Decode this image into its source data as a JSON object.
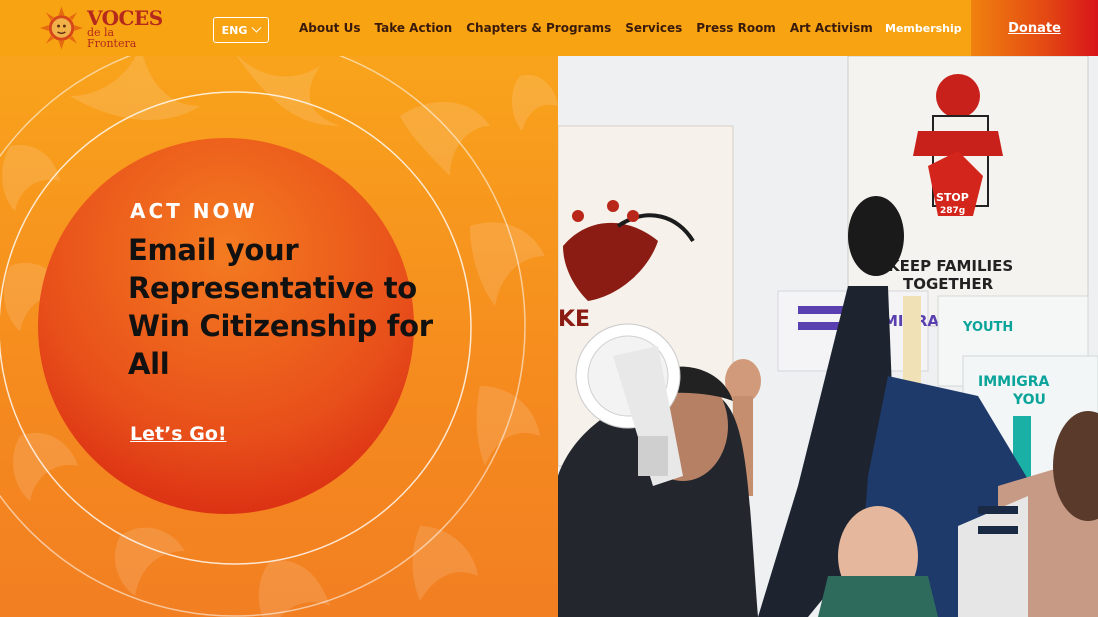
{
  "brand": {
    "name_line1": "VOCES",
    "name_line2": "de la Frontera"
  },
  "header": {
    "language": "ENG",
    "nav": [
      "About Us",
      "Take Action",
      "Chapters & Programs",
      "Services",
      "Press Room",
      "Art Activism"
    ],
    "membership": "Membership",
    "donate": "Donate"
  },
  "hero": {
    "eyebrow": "ACT NOW",
    "headline": "Email your Representative to Win Citizenship for All",
    "cta": "Let’s Go!"
  },
  "photo": {
    "signs": {
      "stop": "STOP",
      "stop_num": "287g",
      "keep_1": "KEEP FAMILIES",
      "keep_2": "TOGETHER",
      "immigrant_youth_1": "IMMIGRA",
      "immigrant_youth_2": "YOU",
      "left_sign": "KE",
      "migra": "MIGRA",
      "youth": "YOUTH"
    }
  },
  "colors": {
    "accent": "#f7a312",
    "donate_red": "#d8141a",
    "circle_red": "#e0341a",
    "text_dark": "#111111"
  }
}
